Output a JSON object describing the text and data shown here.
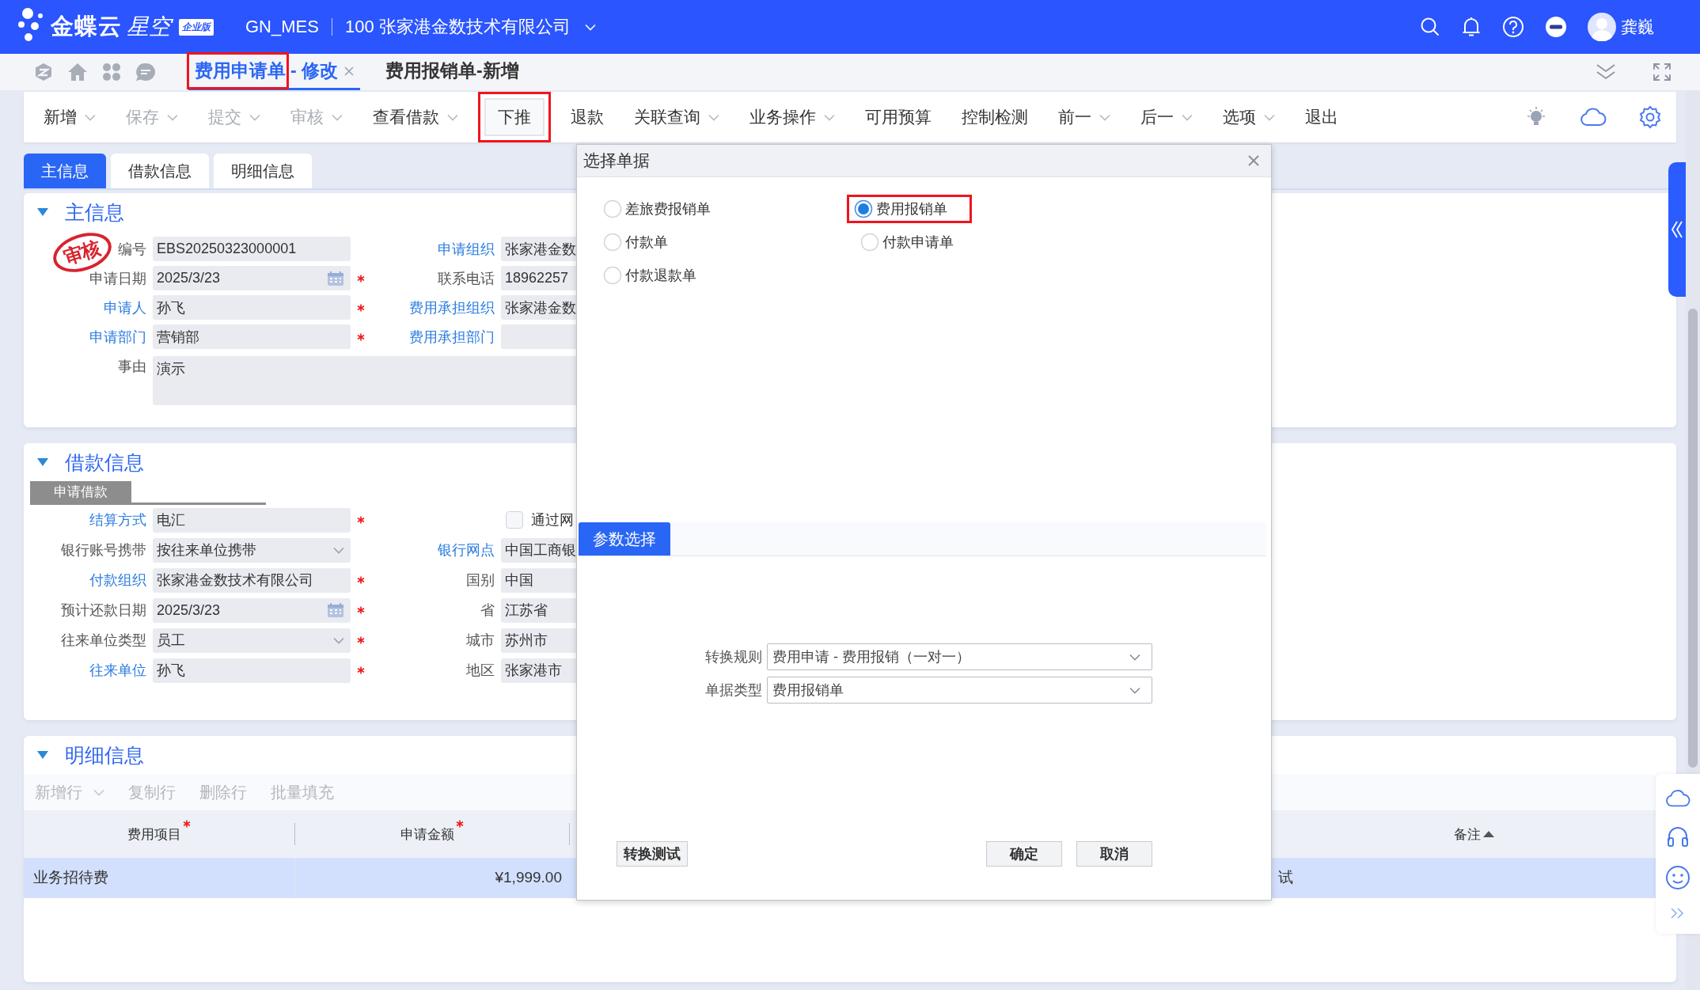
{
  "header": {
    "logo": {
      "brand": "金蝶云",
      "product": "星空",
      "edition": "企业版"
    },
    "database": "GN_MES",
    "organization": "100 张家港金数技术有限公司",
    "user": "龚巍"
  },
  "tabs": [
    {
      "label": "费用申请单",
      "suffix": "- 修改",
      "selected": true,
      "highlighted": true,
      "closable": true
    },
    {
      "label": "费用报销单-新增",
      "selected": false,
      "highlighted": false,
      "closable": false
    }
  ],
  "toolbar": [
    {
      "label": "新增",
      "dropdown": true,
      "disabled": false,
      "highlighted": false
    },
    {
      "label": "保存",
      "dropdown": true,
      "disabled": true,
      "highlighted": false
    },
    {
      "label": "提交",
      "dropdown": true,
      "disabled": true,
      "highlighted": false
    },
    {
      "label": "审核",
      "dropdown": true,
      "disabled": true,
      "highlighted": false
    },
    {
      "label": "查看借款",
      "dropdown": true,
      "disabled": false,
      "highlighted": false
    },
    {
      "label": "下推",
      "dropdown": false,
      "disabled": false,
      "highlighted": true
    },
    {
      "label": "退款",
      "dropdown": false,
      "disabled": false,
      "highlighted": false
    },
    {
      "label": "关联查询",
      "dropdown": true,
      "disabled": false,
      "highlighted": false
    },
    {
      "label": "业务操作",
      "dropdown": true,
      "disabled": false,
      "highlighted": false
    },
    {
      "label": "可用预算",
      "dropdown": false,
      "disabled": false,
      "highlighted": false
    },
    {
      "label": "控制检测",
      "dropdown": false,
      "disabled": false,
      "highlighted": false
    },
    {
      "label": "前一",
      "dropdown": true,
      "disabled": false,
      "highlighted": false
    },
    {
      "label": "后一",
      "dropdown": true,
      "disabled": false,
      "highlighted": false
    },
    {
      "label": "选项",
      "dropdown": true,
      "disabled": false,
      "highlighted": false
    },
    {
      "label": "退出",
      "dropdown": false,
      "disabled": false,
      "highlighted": false
    }
  ],
  "form_tabs": [
    {
      "label": "主信息",
      "selected": true
    },
    {
      "label": "借款信息",
      "selected": false
    },
    {
      "label": "明细信息",
      "selected": false
    }
  ],
  "main_info": {
    "title": "主信息",
    "expanded": true,
    "stamp": "审核",
    "rows": [
      {
        "left": {
          "kind": "text",
          "label": "编号",
          "value": "EBS20250323000001",
          "link": false,
          "required": false
        },
        "right": {
          "kind": "text",
          "label": "申请组织",
          "value": "张家港金数",
          "link": true,
          "required": false
        }
      },
      {
        "left": {
          "kind": "date",
          "label": "申请日期",
          "value": "2025/3/23",
          "link": false,
          "required": true
        },
        "right": {
          "kind": "text",
          "label": "联系电话",
          "value": "18962257",
          "link": false,
          "required": false
        }
      },
      {
        "left": {
          "kind": "text",
          "label": "申请人",
          "value": "孙飞",
          "link": true,
          "required": true
        },
        "right": {
          "kind": "text",
          "label": "费用承担组织",
          "value": "张家港金数",
          "link": true,
          "required": false
        }
      },
      {
        "left": {
          "kind": "text",
          "label": "申请部门",
          "value": "营销部",
          "link": true,
          "required": true
        },
        "right": {
          "kind": "text",
          "label": "费用承担部门",
          "link": true,
          "required": false
        }
      }
    ],
    "reason": {
      "kind": "textarea",
      "label": "事由",
      "value": "演示",
      "link": false,
      "required": false
    }
  },
  "loan_info": {
    "title": "借款信息",
    "expanded": true,
    "subtab": "申请借款",
    "rows": [
      {
        "left": {
          "kind": "text",
          "label": "结算方式",
          "value": "电汇",
          "link": true,
          "required": true
        },
        "right": {
          "kind": "checkbox",
          "label": "通过网",
          "checked": false
        }
      },
      {
        "left": {
          "kind": "select",
          "label": "银行账号携带",
          "value": "按往来单位携带",
          "link": false,
          "required": false
        },
        "right": {
          "kind": "text",
          "label": "银行网点",
          "value": "中国工商银",
          "link": true,
          "required": false
        }
      },
      {
        "left": {
          "kind": "text",
          "label": "付款组织",
          "value": "张家港金数技术有限公司",
          "link": true,
          "required": true
        },
        "right": {
          "kind": "text",
          "label": "国别",
          "value": "中国",
          "link": false,
          "required": false
        }
      },
      {
        "left": {
          "kind": "date",
          "label": "预计还款日期",
          "value": "2025/3/23",
          "link": false,
          "required": true
        },
        "right": {
          "kind": "text",
          "label": "省",
          "value": "江苏省",
          "link": false,
          "required": false
        }
      },
      {
        "left": {
          "kind": "select",
          "label": "往来单位类型",
          "value": "员工",
          "link": false,
          "required": true
        },
        "right": {
          "kind": "text",
          "label": "城市",
          "value": "苏州市",
          "link": false,
          "required": false
        }
      },
      {
        "left": {
          "kind": "text",
          "label": "往来单位",
          "value": "孙飞",
          "link": true,
          "required": true
        },
        "right": {
          "kind": "text",
          "label": "地区",
          "value": "张家港市",
          "link": false,
          "required": false
        }
      }
    ]
  },
  "detail_info": {
    "title": "明细信息",
    "expanded": true,
    "actions": [
      {
        "label": "新增行",
        "dropdown": true,
        "disabled": true
      },
      {
        "label": "复制行",
        "dropdown": false,
        "disabled": true
      },
      {
        "label": "删除行",
        "dropdown": false,
        "disabled": true
      },
      {
        "label": "批量填充",
        "dropdown": false,
        "disabled": true
      }
    ],
    "table": {
      "columns": [
        {
          "label": "费用项目",
          "required": true,
          "sorted": false
        },
        {
          "label": "申请金额",
          "required": true,
          "sorted": false
        },
        {
          "label": "备注",
          "required": false,
          "sorted": true
        }
      ],
      "rows": [
        {
          "cells": [
            "业务招待费",
            "¥1,999.00",
            "试"
          ],
          "selected": true
        }
      ]
    }
  },
  "dialog": {
    "title": "选择单据",
    "options": [
      {
        "label": "差旅费报销单",
        "selected": false,
        "highlighted": false
      },
      {
        "label": "费用报销单",
        "selected": true,
        "highlighted": true
      },
      {
        "label": "付款单",
        "selected": false,
        "highlighted": false
      },
      {
        "label": "付款申请单",
        "selected": false,
        "highlighted": false
      },
      {
        "label": "付款退款单",
        "selected": false,
        "highlighted": false
      }
    ],
    "param_tab": {
      "label": "参数选择",
      "selected": true
    },
    "fields": [
      {
        "label": "转换规则",
        "value": "费用申请 - 费用报销（一对一）"
      },
      {
        "label": "单据类型",
        "value": "费用报销单"
      }
    ],
    "footer": {
      "extra": [
        "转换测试"
      ],
      "actions": [
        "确定",
        "取消"
      ]
    }
  }
}
